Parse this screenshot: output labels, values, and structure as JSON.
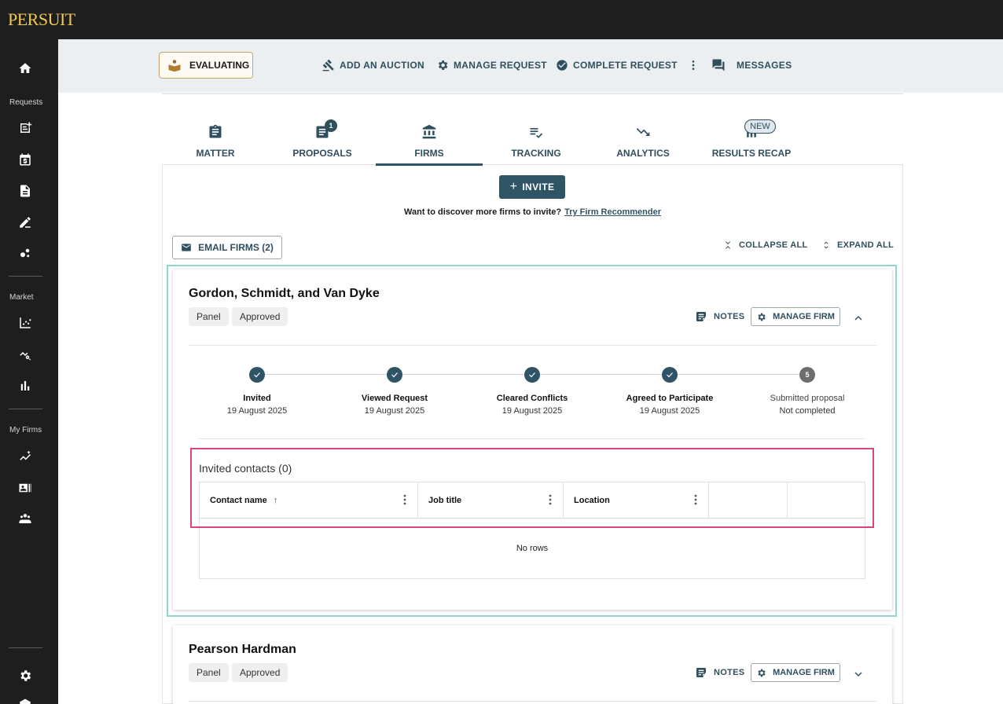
{
  "app": {
    "logo": "PERSUIT"
  },
  "sidebar": {
    "sections": {
      "requests": "Requests",
      "market": "Market",
      "my_firms": "My Firms"
    }
  },
  "action_bar": {
    "status": "EVALUATING",
    "add_auction": "ADD AN AUCTION",
    "manage_request": "MANAGE REQUEST",
    "complete_request": "COMPLETE REQUEST",
    "messages": "MESSAGES"
  },
  "tabs": [
    {
      "label": "MATTER"
    },
    {
      "label": "PROPOSALS",
      "badge": "1"
    },
    {
      "label": "FIRMS",
      "active": true
    },
    {
      "label": "TRACKING"
    },
    {
      "label": "ANALYTICS"
    },
    {
      "label": "RESULTS RECAP",
      "badge": "NEW"
    }
  ],
  "invite": {
    "button": "INVITE",
    "discover_text": "Want to discover more firms to invite?",
    "discover_link": "Try Firm Recommender"
  },
  "toolbar": {
    "email_firms": "EMAIL FIRMS (2)",
    "collapse_all": "COLLAPSE ALL",
    "expand_all": "EXPAND ALL"
  },
  "firms": [
    {
      "name": "Gordon, Schmidt, and Van Dyke",
      "tags": [
        "Panel",
        "Approved"
      ],
      "notes": "NOTES",
      "manage": "MANAGE FIRM",
      "steps": [
        {
          "title": "Invited",
          "date": "19 August 2025",
          "done": true
        },
        {
          "title": "Viewed Request",
          "date": "19 August 2025",
          "done": true
        },
        {
          "title": "Cleared Conflicts",
          "date": "19 August 2025",
          "done": true
        },
        {
          "title": "Agreed to Participate",
          "date": "19 August 2025",
          "done": true
        },
        {
          "title": "Submitted proposal",
          "date": "Not completed",
          "done": false,
          "number": "5"
        }
      ],
      "contacts": {
        "title": "Invited contacts (0)",
        "columns": [
          "Contact name",
          "Job title",
          "Location"
        ],
        "empty": "No rows"
      }
    },
    {
      "name": "Pearson Hardman",
      "tags": [
        "Panel",
        "Approved"
      ],
      "notes": "NOTES",
      "manage": "MANAGE FIRM"
    }
  ],
  "colors": {
    "primary": "#2f5466",
    "gold": "#c9a468",
    "highlight_teal": "#8fd6cf",
    "highlight_pink": "#d9457f"
  }
}
